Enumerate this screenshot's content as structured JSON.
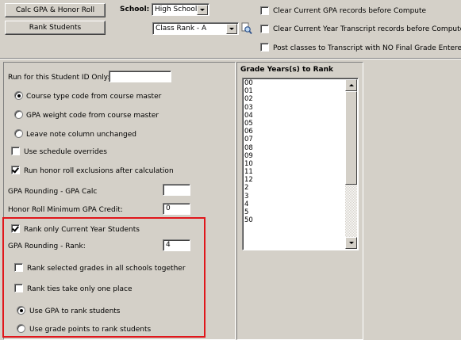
{
  "toolbar": {
    "calc_label": "Calc GPA & Honor Roll",
    "rank_label": "Rank Students",
    "school_label": "School:",
    "school_value": "High School",
    "rank_type_value": "Class Rank - A",
    "options": [
      {
        "label": "Clear Current GPA records before Compute",
        "checked": false
      },
      {
        "label": "Clear Current Year Transcript records before Compute",
        "checked": false
      },
      {
        "label": "Post classes to Transcript with NO Final Grade Entered",
        "checked": false
      }
    ]
  },
  "form": {
    "student_id_label": "Run for this Student ID Only:",
    "student_id_value": "",
    "radio_course_type": "Course type code from course master",
    "radio_gpa_weight": "GPA weight code from course master",
    "radio_leave_note": "Leave note column unchanged",
    "chk_schedule_overrides": "Use schedule overrides",
    "chk_honor_roll_exclusions": "Run honor roll exclusions after calculation",
    "gpa_rounding_calc_label": "GPA Rounding - GPA Calc",
    "gpa_rounding_calc_value": "",
    "honor_roll_min_label": "Honor Roll Minimum GPA Credit:",
    "honor_roll_min_value": "0",
    "chk_rank_current_year": "Rank only Current Year Students",
    "gpa_rounding_rank_label": "GPA Rounding - Rank:",
    "gpa_rounding_rank_value": "4",
    "chk_rank_all_schools": "Rank selected grades in all schools together",
    "chk_rank_ties": "Rank ties take only one place",
    "radio_use_gpa": "Use GPA to rank students",
    "radio_use_grade_points": "Use grade points to rank students"
  },
  "grades": {
    "title": "Grade Years(s) to Rank",
    "items": [
      "00",
      "01",
      "02",
      "03",
      "04",
      "05",
      "06",
      "07",
      "08",
      "09",
      "10",
      "11",
      "12",
      "2",
      "3",
      "4",
      "5",
      "50"
    ]
  },
  "colors": {
    "background": "#d4d0c8",
    "highlight_border": "#e0161b"
  }
}
